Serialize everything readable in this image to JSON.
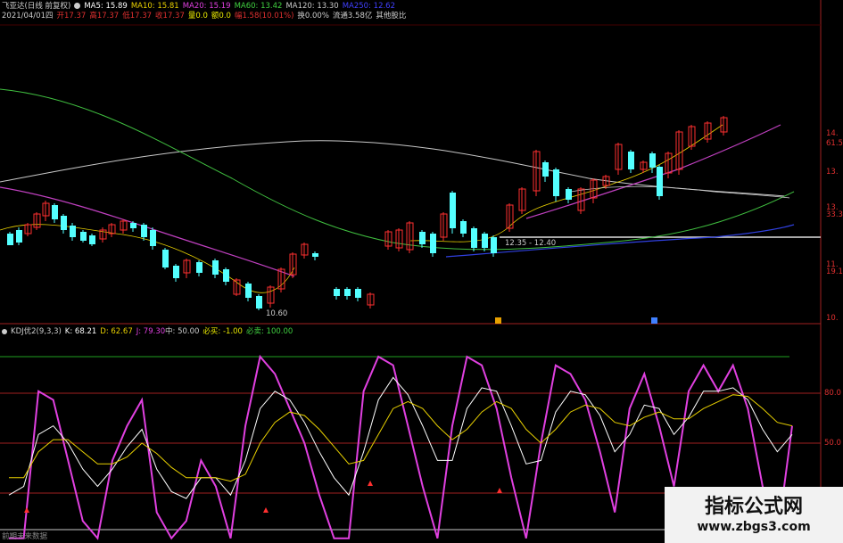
{
  "header": {
    "title": "飞亚达(日线 前复权)",
    "ma": [
      {
        "label": "MA5: 15.89",
        "color": "#ffffff"
      },
      {
        "label": "MA10: 15.81",
        "color": "#e8d000"
      },
      {
        "label": "MA20: 15.19",
        "color": "#e040e0"
      },
      {
        "label": "MA60: 13.42",
        "color": "#40d040"
      },
      {
        "label": "MA120: 13.30",
        "color": "#c8c8c8"
      },
      {
        "label": "MA250: 12.62",
        "color": "#4040ff"
      }
    ]
  },
  "quote": [
    {
      "label": "2021/04/01四",
      "color": "#cccccc"
    },
    {
      "label": "开17.37",
      "color": "#e03030"
    },
    {
      "label": "高17.37",
      "color": "#e03030"
    },
    {
      "label": "低17.37",
      "color": "#e03030"
    },
    {
      "label": "收17.37",
      "color": "#e03030"
    },
    {
      "label": "量0.0",
      "color": "#e8e800"
    },
    {
      "label": "额0.0",
      "color": "#e8e800"
    },
    {
      "label": "幅1.58(10.01%)",
      "color": "#e03030"
    },
    {
      "label": "换0.00%",
      "color": "#cccccc"
    },
    {
      "label": "流通3.58亿",
      "color": "#cccccc"
    },
    {
      "label": "其他股比",
      "color": "#cccccc"
    }
  ],
  "price_annotations": {
    "low": "10.60",
    "range": "12.35 - 12.40"
  },
  "price_axis": [
    "14.",
    "61.5",
    "13.",
    "13.",
    "33.3",
    "11.",
    "19.1",
    "10."
  ],
  "kdj": {
    "title": "KDJ优2(9,3,3)",
    "k": "K: 68.21",
    "d": "D: 62.67",
    "j": "J: 79.30",
    "mid": "中: 50.00",
    "buy": "必买: -1.00",
    "sell": "必卖: 100.00"
  },
  "kdj_axis": [
    "80.0",
    "50.0"
  ],
  "footer_text": "前期未来数据",
  "watermark": {
    "line1": "指标公式网",
    "line2": "www.zbgs3.com"
  },
  "chart_data": {
    "type": "line",
    "kdj_series": [
      {
        "name": "J",
        "color": "#e040e0",
        "values": [
          -5,
          -5,
          80,
          75,
          40,
          5,
          -5,
          40,
          60,
          75,
          10,
          -5,
          5,
          40,
          25,
          -5,
          60,
          100,
          90,
          70,
          50,
          20,
          -5,
          -5,
          80,
          100,
          95,
          60,
          25,
          -5,
          60,
          100,
          95,
          70,
          30,
          -5,
          50,
          95,
          90,
          75,
          45,
          10,
          70,
          90,
          60,
          25,
          80,
          95,
          80,
          95,
          70,
          25,
          -5,
          60
        ]
      },
      {
        "name": "K",
        "color": "#ffffff",
        "values": [
          20,
          25,
          55,
          60,
          50,
          35,
          25,
          35,
          48,
          58,
          35,
          22,
          18,
          30,
          30,
          20,
          40,
          70,
          80,
          75,
          62,
          45,
          30,
          20,
          45,
          75,
          88,
          78,
          60,
          40,
          40,
          70,
          82,
          80,
          60,
          38,
          40,
          68,
          80,
          78,
          66,
          45,
          55,
          72,
          70,
          55,
          65,
          80,
          80,
          82,
          75,
          58,
          45,
          55
        ]
      },
      {
        "name": "D",
        "color": "#e8d000",
        "values": [
          30,
          30,
          45,
          52,
          52,
          45,
          38,
          38,
          42,
          50,
          44,
          36,
          30,
          30,
          30,
          28,
          32,
          50,
          62,
          68,
          66,
          58,
          48,
          38,
          40,
          55,
          70,
          74,
          70,
          60,
          52,
          58,
          68,
          74,
          70,
          58,
          50,
          58,
          68,
          72,
          70,
          62,
          60,
          65,
          68,
          64,
          64,
          70,
          74,
          78,
          77,
          70,
          62,
          60
        ]
      }
    ]
  }
}
